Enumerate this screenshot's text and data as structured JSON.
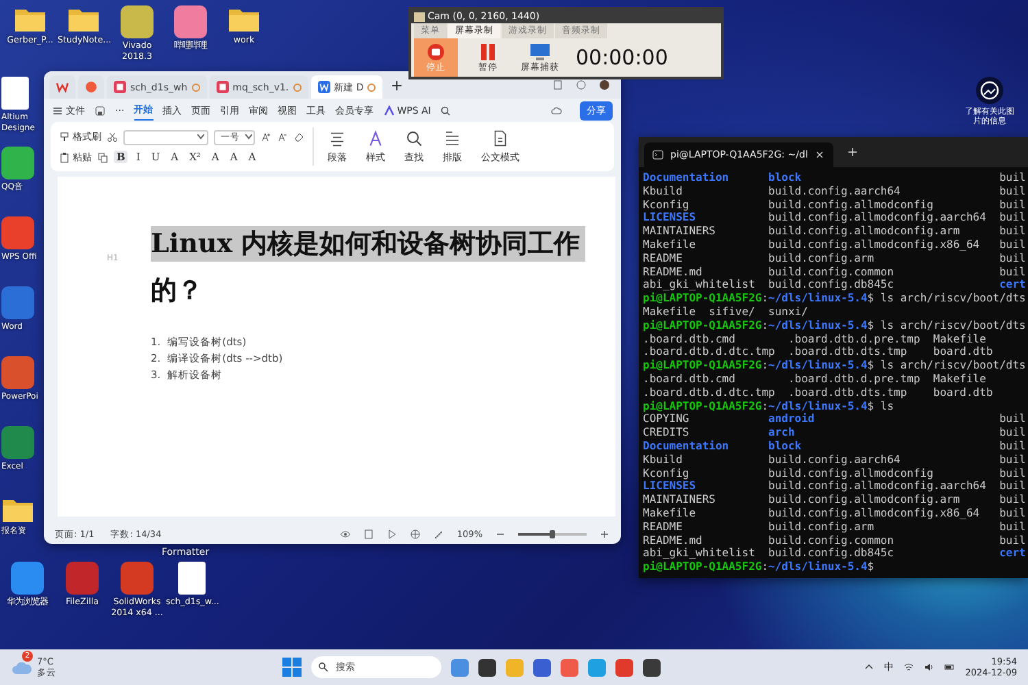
{
  "desktop": {
    "top_row": [
      {
        "label": "Gerber_P...",
        "kind": "folder"
      },
      {
        "label": "StudyNote...",
        "kind": "folder"
      },
      {
        "label": "Vivado 2018.3",
        "kind": "app",
        "color": "#c9b84a"
      },
      {
        "label": "哔哩哔哩",
        "kind": "app",
        "color": "#f07ca0"
      },
      {
        "label": "work",
        "kind": "folder"
      }
    ],
    "left_column": [
      {
        "label": "Altium Designe",
        "kind": "file"
      },
      {
        "label": "QQ音",
        "kind": "app",
        "color": "#2fb34a"
      },
      {
        "label": "WPS Offi",
        "kind": "app",
        "color": "#e8402a"
      },
      {
        "label": "Word",
        "kind": "app",
        "color": "#2b6fd6"
      },
      {
        "label": "PowerPoi",
        "kind": "app",
        "color": "#d8502c"
      },
      {
        "label": "Excel",
        "kind": "app",
        "color": "#1f8a4c"
      },
      {
        "label": "报名资",
        "kind": "folder"
      }
    ],
    "bottom_row": [
      {
        "label": "华为浏览器",
        "kind": "app",
        "color": "#2a8cf0"
      },
      {
        "label": "FileZilla",
        "kind": "app",
        "color": "#c0262a"
      },
      {
        "label": "SolidWorks 2014 x64 ...",
        "kind": "app",
        "color": "#d43a22"
      },
      {
        "label": "sch_d1s_w...",
        "kind": "file"
      }
    ],
    "covered_label": "Formatter",
    "info_caption": "了解有关此图片的信息"
  },
  "recorder": {
    "title": "Cam (0, 0, 2160, 1440)",
    "tabs": [
      {
        "label": "菜单",
        "selected": false
      },
      {
        "label": "屏幕录制",
        "selected": true
      },
      {
        "label": "游戏录制",
        "selected": false
      },
      {
        "label": "音频录制",
        "selected": false
      }
    ],
    "buttons": [
      {
        "label": "停止",
        "kind": "stop",
        "active": true
      },
      {
        "label": "暂停",
        "kind": "pause",
        "active": false
      },
      {
        "label": "屏幕捕获",
        "kind": "capture",
        "active": false
      }
    ],
    "timer": "00:00:00"
  },
  "wps": {
    "tabs": [
      {
        "kind": "logo",
        "selected": false
      },
      {
        "kind": "app",
        "selected": false
      },
      {
        "kind": "pdf",
        "label": "sch_d1s_wh",
        "selected": false
      },
      {
        "kind": "pdf",
        "label": "mq_sch_v1.",
        "selected": false
      },
      {
        "kind": "doc",
        "label": "新建 D",
        "selected": true
      }
    ],
    "menu": [
      {
        "label": "文件",
        "selected": false
      },
      {
        "label": "开始",
        "selected": true
      },
      {
        "label": "插入",
        "selected": false
      },
      {
        "label": "页面",
        "selected": false
      },
      {
        "label": "引用",
        "selected": false
      },
      {
        "label": "审阅",
        "selected": false
      },
      {
        "label": "视图",
        "selected": false
      },
      {
        "label": "工具",
        "selected": false
      },
      {
        "label": "会员专享",
        "selected": false
      },
      {
        "label": "WPS AI",
        "selected": false
      }
    ],
    "more": "···",
    "share": "分享",
    "ribbon": {
      "format_painter": "格式刷",
      "paste": "粘贴",
      "font_size": "一号",
      "format_glyphs": [
        "B",
        "I",
        "U",
        "A",
        "X²",
        "A",
        "A",
        "A"
      ],
      "groups": [
        {
          "label": "段落",
          "kind": "paragraph"
        },
        {
          "label": "样式",
          "kind": "style"
        },
        {
          "label": "查找",
          "kind": "find"
        },
        {
          "label": "排版",
          "kind": "layout"
        },
        {
          "label": "公文模式",
          "kind": "document"
        }
      ]
    },
    "document": {
      "heading_marker": "H1",
      "heading": [
        {
          "text": "Linux  内核是如何和设备树协同工作",
          "highlighted": true
        },
        {
          "text": "的？",
          "highlighted": false
        }
      ],
      "list": [
        {
          "number": "1.",
          "text": "编写设备树(dts)"
        },
        {
          "number": "2.",
          "text": "编译设备树(dts -->dtb)"
        },
        {
          "number": "3.",
          "text": "解析设备树"
        }
      ]
    },
    "status": {
      "page": "页面: 1/1",
      "words": "字数: 14/34",
      "zoom": "109%",
      "zoom_slider": {
        "level": 0.5
      }
    }
  },
  "terminal": {
    "tab_title": "pi@LAPTOP-Q1AA5F2G: ~/dl",
    "lines": [
      {
        "kind": "ls",
        "cells": [
          {
            "text": "Documentation",
            "kind": "dir"
          },
          {
            "text": "block",
            "kind": "dir"
          },
          {
            "text": "buil",
            "kind": "file"
          }
        ]
      },
      {
        "kind": "ls",
        "cells": [
          {
            "text": "Kbuild",
            "kind": "file"
          },
          {
            "text": "build.config.aarch64",
            "kind": "file"
          },
          {
            "text": "buil",
            "kind": "file"
          }
        ]
      },
      {
        "kind": "ls",
        "cells": [
          {
            "text": "Kconfig",
            "kind": "file"
          },
          {
            "text": "build.config.allmodconfig",
            "kind": "file"
          },
          {
            "text": "buil",
            "kind": "file"
          }
        ]
      },
      {
        "kind": "ls",
        "cells": [
          {
            "text": "LICENSES",
            "kind": "dir"
          },
          {
            "text": "build.config.allmodconfig.aarch64",
            "kind": "file"
          },
          {
            "text": "buil",
            "kind": "file"
          }
        ]
      },
      {
        "kind": "ls",
        "cells": [
          {
            "text": "MAINTAINERS",
            "kind": "file"
          },
          {
            "text": "build.config.allmodconfig.arm",
            "kind": "file"
          },
          {
            "text": "buil",
            "kind": "file"
          }
        ]
      },
      {
        "kind": "ls",
        "cells": [
          {
            "text": "Makefile",
            "kind": "file"
          },
          {
            "text": "build.config.allmodconfig.x86_64",
            "kind": "file"
          },
          {
            "text": "buil",
            "kind": "file"
          }
        ]
      },
      {
        "kind": "ls",
        "cells": [
          {
            "text": "README",
            "kind": "file"
          },
          {
            "text": "build.config.arm",
            "kind": "file"
          },
          {
            "text": "buil",
            "kind": "file"
          }
        ]
      },
      {
        "kind": "ls",
        "cells": [
          {
            "text": "README.md",
            "kind": "file"
          },
          {
            "text": "build.config.common",
            "kind": "file"
          },
          {
            "text": "buil",
            "kind": "file"
          }
        ]
      },
      {
        "kind": "ls",
        "cells": [
          {
            "text": "abi_gki_whitelist",
            "kind": "file"
          },
          {
            "text": "build.config.db845c",
            "kind": "file"
          },
          {
            "text": "cert",
            "kind": "dir"
          }
        ]
      },
      {
        "kind": "prompt",
        "cells": [
          {
            "text": "pi@LAPTOP-Q1AA5F2G",
            "kind": "user"
          },
          {
            "text": ":",
            "kind": "file"
          },
          {
            "text": "~/dls/linux-5.4",
            "kind": "path"
          },
          {
            "text": "$ ls arch/riscv/boot/dts",
            "kind": "file"
          }
        ]
      },
      {
        "kind": "plain",
        "cells": [
          {
            "text": "Makefile",
            "kind": "file"
          },
          {
            "text": "sifive/",
            "kind": "file"
          },
          {
            "text": "sunxi/",
            "kind": "file"
          }
        ]
      },
      {
        "kind": "prompt",
        "cells": [
          {
            "text": "pi@LAPTOP-Q1AA5F2G",
            "kind": "user"
          },
          {
            "text": ":",
            "kind": "file"
          },
          {
            "text": "~/dls/linux-5.4",
            "kind": "path"
          },
          {
            "text": "$ ls arch/riscv/boot/dts",
            "kind": "file"
          }
        ]
      },
      {
        "kind": "dts",
        "cells": [
          {
            "text": ".board.dtb.cmd",
            "kind": "file"
          },
          {
            "text": ".board.dtb.d.pre.tmp",
            "kind": "file"
          },
          {
            "text": "Makefile",
            "kind": "file"
          }
        ]
      },
      {
        "kind": "dts",
        "cells": [
          {
            "text": ".board.dtb.d.dtc.tmp",
            "kind": "file"
          },
          {
            "text": ".board.dtb.dts.tmp",
            "kind": "file"
          },
          {
            "text": "board.dtb",
            "kind": "file"
          }
        ]
      },
      {
        "kind": "prompt",
        "cells": [
          {
            "text": "pi@LAPTOP-Q1AA5F2G",
            "kind": "user"
          },
          {
            "text": ":",
            "kind": "file"
          },
          {
            "text": "~/dls/linux-5.4",
            "kind": "path"
          },
          {
            "text": "$ ls arch/riscv/boot/dts",
            "kind": "file"
          }
        ]
      },
      {
        "kind": "dts",
        "cells": [
          {
            "text": ".board.dtb.cmd",
            "kind": "file"
          },
          {
            "text": ".board.dtb.d.pre.tmp",
            "kind": "file"
          },
          {
            "text": "Makefile",
            "kind": "file"
          }
        ]
      },
      {
        "kind": "dts",
        "cells": [
          {
            "text": ".board.dtb.d.dtc.tmp",
            "kind": "file"
          },
          {
            "text": ".board.dtb.dts.tmp",
            "kind": "file"
          },
          {
            "text": "board.dtb",
            "kind": "file"
          }
        ]
      },
      {
        "kind": "prompt",
        "cells": [
          {
            "text": "pi@LAPTOP-Q1AA5F2G",
            "kind": "user"
          },
          {
            "text": ":",
            "kind": "file"
          },
          {
            "text": "~/dls/linux-5.4",
            "kind": "path"
          },
          {
            "text": "$ ls",
            "kind": "file"
          }
        ]
      },
      {
        "kind": "ls",
        "cells": [
          {
            "text": "COPYING",
            "kind": "file"
          },
          {
            "text": "android",
            "kind": "dir"
          },
          {
            "text": "buil",
            "kind": "file"
          }
        ]
      },
      {
        "kind": "ls",
        "cells": [
          {
            "text": "CREDITS",
            "kind": "file"
          },
          {
            "text": "arch",
            "kind": "dir"
          },
          {
            "text": "buil",
            "kind": "file"
          }
        ]
      },
      {
        "kind": "ls",
        "cells": [
          {
            "text": "Documentation",
            "kind": "dir"
          },
          {
            "text": "block",
            "kind": "dir"
          },
          {
            "text": "buil",
            "kind": "file"
          }
        ]
      },
      {
        "kind": "ls",
        "cells": [
          {
            "text": "Kbuild",
            "kind": "file"
          },
          {
            "text": "build.config.aarch64",
            "kind": "file"
          },
          {
            "text": "buil",
            "kind": "file"
          }
        ]
      },
      {
        "kind": "ls",
        "cells": [
          {
            "text": "Kconfig",
            "kind": "file"
          },
          {
            "text": "build.config.allmodconfig",
            "kind": "file"
          },
          {
            "text": "buil",
            "kind": "file"
          }
        ]
      },
      {
        "kind": "ls",
        "cells": [
          {
            "text": "LICENSES",
            "kind": "dir"
          },
          {
            "text": "build.config.allmodconfig.aarch64",
            "kind": "file"
          },
          {
            "text": "buil",
            "kind": "file"
          }
        ]
      },
      {
        "kind": "ls",
        "cells": [
          {
            "text": "MAINTAINERS",
            "kind": "file"
          },
          {
            "text": "build.config.allmodconfig.arm",
            "kind": "file"
          },
          {
            "text": "buil",
            "kind": "file"
          }
        ]
      },
      {
        "kind": "ls",
        "cells": [
          {
            "text": "Makefile",
            "kind": "file"
          },
          {
            "text": "build.config.allmodconfig.x86_64",
            "kind": "file"
          },
          {
            "text": "buil",
            "kind": "file"
          }
        ]
      },
      {
        "kind": "ls",
        "cells": [
          {
            "text": "README",
            "kind": "file"
          },
          {
            "text": "build.config.arm",
            "kind": "file"
          },
          {
            "text": "buil",
            "kind": "file"
          }
        ]
      },
      {
        "kind": "ls",
        "cells": [
          {
            "text": "README.md",
            "kind": "file"
          },
          {
            "text": "build.config.common",
            "kind": "file"
          },
          {
            "text": "buil",
            "kind": "file"
          }
        ]
      },
      {
        "kind": "ls",
        "cells": [
          {
            "text": "abi_gki_whitelist",
            "kind": "file"
          },
          {
            "text": "build.config.db845c",
            "kind": "file"
          },
          {
            "text": "cert",
            "kind": "dir"
          }
        ]
      },
      {
        "kind": "prompt",
        "cells": [
          {
            "text": "pi@LAPTOP-Q1AA5F2G",
            "kind": "user"
          },
          {
            "text": ":",
            "kind": "file"
          },
          {
            "text": "~/dls/linux-5.4",
            "kind": "path"
          },
          {
            "text": "$",
            "kind": "file"
          }
        ]
      }
    ]
  },
  "taskbar": {
    "weather": {
      "badge": "2",
      "temperature": "7°C",
      "condition": "多云"
    },
    "search": {
      "placeholder": "搜索"
    },
    "apps": [
      {
        "color": "#4a8fe0"
      },
      {
        "color": "#333333"
      },
      {
        "color": "#f0b429"
      },
      {
        "color": "#3a5fd0"
      },
      {
        "color": "#f05a4a"
      },
      {
        "color": "#1fa0e0"
      },
      {
        "color": "#e03a2a"
      },
      {
        "color": "#3a3a3a"
      }
    ],
    "ime": "中",
    "time": "19:54",
    "date": "2024-12-09"
  }
}
